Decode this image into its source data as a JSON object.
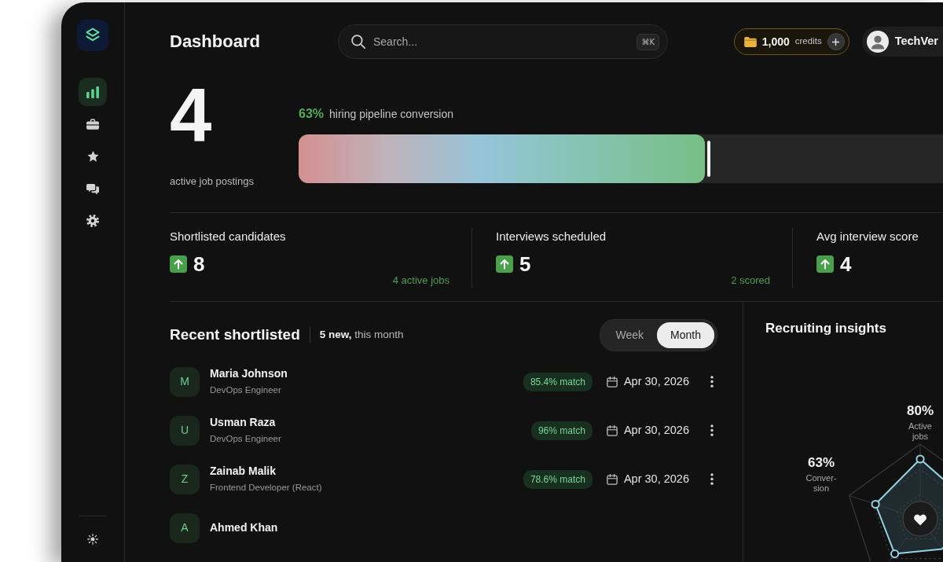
{
  "sidebar": {
    "items": [
      {
        "kind": "analytics",
        "selected": true
      },
      {
        "kind": "jobs",
        "selected": false
      },
      {
        "kind": "favorites",
        "selected": false
      },
      {
        "kind": "messages",
        "selected": false
      },
      {
        "kind": "settings",
        "selected": false
      }
    ]
  },
  "header": {
    "title": "Dashboard",
    "search": {
      "placeholder": "Search...",
      "shortcut": "⌘K"
    },
    "credits": {
      "amount": "1,000",
      "unit": "credits"
    },
    "user": {
      "name": "TechVer"
    }
  },
  "hero": {
    "value": "4",
    "label": "active job postings"
  },
  "pipeline": {
    "percent": "63%",
    "label": "hiring pipeline conversion",
    "level": 0.63
  },
  "stats": [
    {
      "label": "Shortlisted candidates",
      "rising": true,
      "value": "8",
      "note": "4 active jobs"
    },
    {
      "label": "Interviews scheduled",
      "rising": true,
      "value": "5",
      "note": "2 scored"
    },
    {
      "label": "Avg interview score",
      "rising": true,
      "value": "4"
    }
  ],
  "recent": {
    "title": "Recent shortlisted",
    "summary": "**5 new,** this month",
    "periods": [
      {
        "label": "Week",
        "selected": false
      },
      {
        "label": "Month",
        "selected": true
      }
    ],
    "candidates": [
      {
        "initial": "M",
        "name": "Maria Johnson",
        "role": "DevOps Engineer",
        "match": "85.4% match",
        "date": "Apr 30, 2026"
      },
      {
        "initial": "U",
        "name": "Usman Raza",
        "role": "DevOps Engineer",
        "match": "96% match",
        "date": "Apr 30, 2026"
      },
      {
        "initial": "Z",
        "name": "Zainab Malik",
        "role": "Frontend Developer (React)",
        "match": "78.6% match",
        "date": "Apr 30, 2026"
      },
      {
        "initial": "A",
        "name": "Ahmed Khan"
      }
    ]
  },
  "insights": {
    "title": "Recruiting insights",
    "metrics": [
      {
        "value": "80%",
        "label": "Active jobs"
      },
      {
        "value": "63%",
        "label": "Conver-sion"
      }
    ]
  }
}
